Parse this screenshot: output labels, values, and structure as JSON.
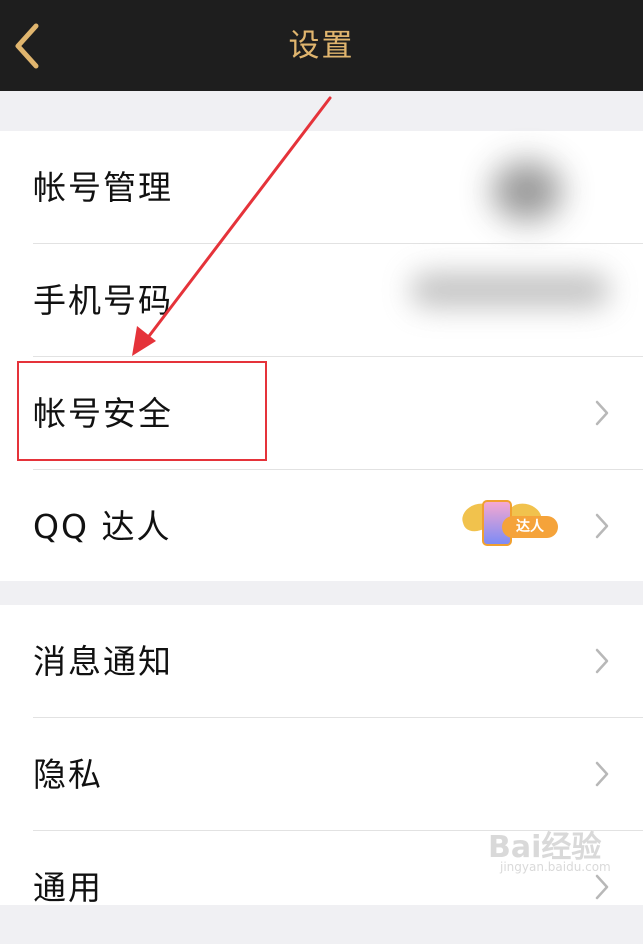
{
  "header": {
    "title": "设置"
  },
  "group1": {
    "items": [
      {
        "label": "帐号管理"
      },
      {
        "label": "手机号码"
      },
      {
        "label": "帐号安全"
      },
      {
        "label": "QQ 达人",
        "badge": "达人"
      }
    ]
  },
  "group2": {
    "items": [
      {
        "label": "消息通知"
      },
      {
        "label": "隐私"
      },
      {
        "label": "通用"
      }
    ]
  },
  "watermark": {
    "logo": "Bai经验",
    "url": "jingyan.baidu.com"
  },
  "colors": {
    "header_bg": "#1e1e1e",
    "accent": "#e0b56e",
    "highlight": "#e5333a",
    "background": "#f0f0f3"
  }
}
